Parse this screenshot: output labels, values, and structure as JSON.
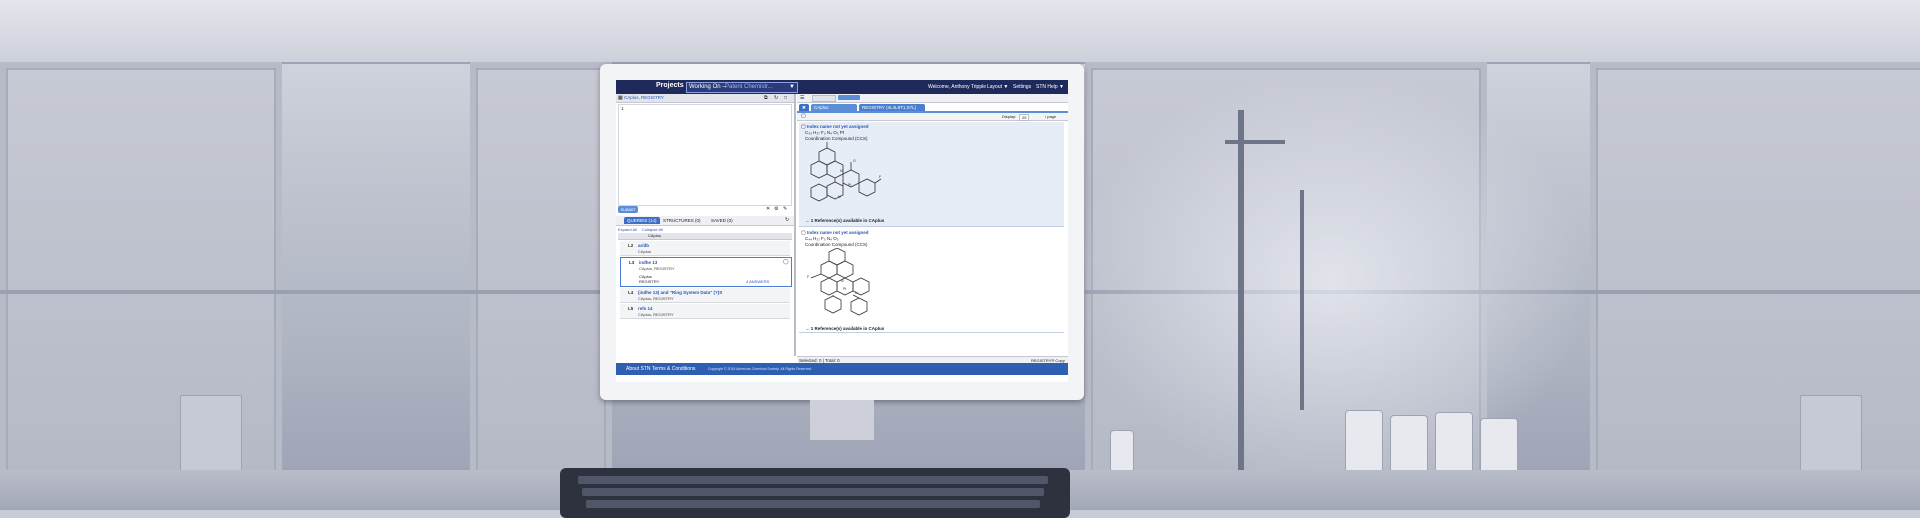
{
  "app": {
    "projects": "Projects",
    "working_on_prefix": "Working On –",
    "working_on_value": "Patent Chemistr...",
    "welcome": "Welcome, Anthony Tripple",
    "layout": "Layout ▼",
    "settings": "Settings",
    "help": "STN Help ▼"
  },
  "left_panel": {
    "header_title": "CAplus, REGISTRY",
    "editor_value": "1",
    "submit_button": "SUBMIT",
    "tabs": [
      {
        "label": "QUERIES (14)"
      },
      {
        "label": "STRUCTURES (0)"
      },
      {
        "label": "SAVED (0)"
      }
    ],
    "expand_all": "Expand All",
    "collapse_all": "Collapse All",
    "column_header": "CAplus",
    "queries": [
      {
        "num": "L2",
        "text": "ar/db",
        "db": "CAplus"
      },
      {
        "num": "L3",
        "text": "indhe 13",
        "db": "CAplus, REGISTRY",
        "sub_db": "CAplus",
        "sub_db2": "REGISTRY",
        "answers": "4 ANSWERS"
      },
      {
        "num": "L4",
        "text": "(indhe 13) and \"Ring System Data\" (?)S",
        "db": "CAplus, REGISTRY"
      },
      {
        "num": "L5",
        "text": "refs 14",
        "db": "CAplus, REGISTRY"
      }
    ]
  },
  "right_panel": {
    "tabs": [
      {
        "label": "CAplus"
      },
      {
        "label": "REGISTRY (4L4L8T1,S7L)"
      }
    ],
    "display_label": "Display:",
    "display_value": "25",
    "per_page": "/ page",
    "results": [
      {
        "name": "Index name not yet assigned",
        "formula": "C₄₃ H₃₇ F₃ N₄ O₃ Pt",
        "class": "Coordination Compound (CCS)",
        "refs": "→ 1 Reference(s) available in CAplus"
      },
      {
        "name": "Index name not yet assigned",
        "formula": "C₄₄ H₃₇ F₃ N₄ O₃",
        "class": "Coordination Compound (CCS)",
        "refs": "→ 1 Reference(s) available in CAplus"
      }
    ],
    "status": "Selected: 0 | Total: 0",
    "status_right": "REGISTRY® Copy"
  },
  "footer": {
    "about": "About STN",
    "terms": "Terms & Conditions",
    "copyright": "Copyright © 2015 American Chemical Society. All Rights Reserved."
  }
}
